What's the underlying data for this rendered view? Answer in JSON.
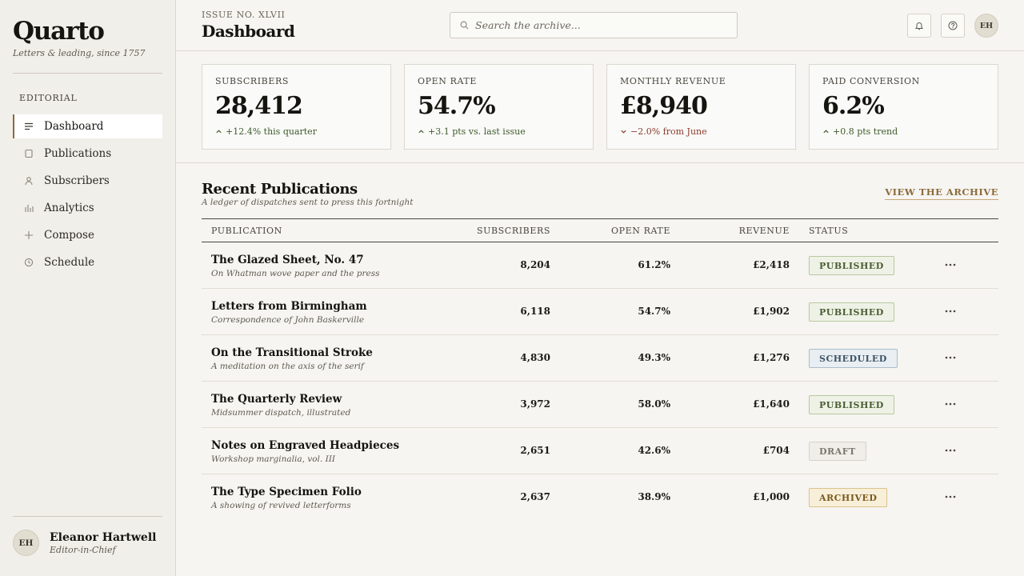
{
  "brand": {
    "name": "Quarto",
    "tagline": "Letters & leading, since 1757"
  },
  "sidebar": {
    "section": "EDITORIAL",
    "items": [
      {
        "label": "Dashboard",
        "icon": "list-icon",
        "active": true
      },
      {
        "label": "Publications",
        "icon": "document-icon"
      },
      {
        "label": "Subscribers",
        "icon": "person-icon"
      },
      {
        "label": "Analytics",
        "icon": "bar-chart-icon"
      },
      {
        "label": "Compose",
        "icon": "plus-icon"
      },
      {
        "label": "Schedule",
        "icon": "clock-icon"
      }
    ],
    "user": {
      "initials": "EH",
      "name": "Eleanor Hartwell",
      "role": "Editor-in-Chief"
    }
  },
  "header": {
    "issue": "ISSUE NO. XLVII",
    "title": "Dashboard",
    "search_placeholder": "Search the archive...",
    "avatar_initials": "EH"
  },
  "stats": [
    {
      "label": "SUBSCRIBERS",
      "value": "28,412",
      "delta": "+12.4% this quarter",
      "trend": "up"
    },
    {
      "label": "OPEN RATE",
      "value": "54.7%",
      "delta": "+3.1 pts vs. last issue",
      "trend": "up"
    },
    {
      "label": "MONTHLY REVENUE",
      "value": "£8,940",
      "delta": "−2.0% from June",
      "trend": "down"
    },
    {
      "label": "PAID CONVERSION",
      "value": "6.2%",
      "delta": "+0.8 pts trend",
      "trend": "up"
    }
  ],
  "recent": {
    "title": "Recent Publications",
    "subtitle": "A ledger of dispatches sent to press this fortnight",
    "view_all": "VIEW THE ARCHIVE",
    "columns": [
      "PUBLICATION",
      "SUBSCRIBERS",
      "OPEN RATE",
      "REVENUE",
      "STATUS"
    ],
    "rows": [
      {
        "title": "The Glazed Sheet, No. 47",
        "subtitle": "On Whatman wove paper and the press",
        "subscribers": "8,204",
        "open_rate": "61.2%",
        "revenue": "£2,418",
        "status": "PUBLISHED",
        "kind": "published"
      },
      {
        "title": "Letters from Birmingham",
        "subtitle": "Correspondence of John Baskerville",
        "subscribers": "6,118",
        "open_rate": "54.7%",
        "revenue": "£1,902",
        "status": "PUBLISHED",
        "kind": "published"
      },
      {
        "title": "On the Transitional Stroke",
        "subtitle": "A meditation on the axis of the serif",
        "subscribers": "4,830",
        "open_rate": "49.3%",
        "revenue": "£1,276",
        "status": "SCHEDULED",
        "kind": "scheduled"
      },
      {
        "title": "The Quarterly Review",
        "subtitle": "Midsummer dispatch, illustrated",
        "subscribers": "3,972",
        "open_rate": "58.0%",
        "revenue": "£1,640",
        "status": "PUBLISHED",
        "kind": "published"
      },
      {
        "title": "Notes on Engraved Headpieces",
        "subtitle": "Workshop marginalia, vol. III",
        "subscribers": "2,651",
        "open_rate": "42.6%",
        "revenue": "£704",
        "status": "DRAFT",
        "kind": "draft"
      },
      {
        "title": "The Type Specimen Folio",
        "subtitle": "A showing of revived letterforms",
        "subscribers": "2,637",
        "open_rate": "38.9%",
        "revenue": "£1,000",
        "status": "ARCHIVED",
        "kind": "archived"
      }
    ]
  }
}
